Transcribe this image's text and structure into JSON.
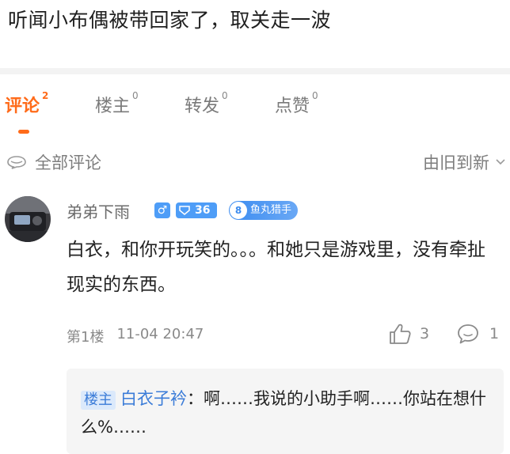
{
  "post": {
    "title": "听闻小布偶被带回家了，取关走一波"
  },
  "tabs": [
    {
      "label": "评论",
      "count": "2",
      "active": true
    },
    {
      "label": "楼主",
      "count": "0",
      "active": false
    },
    {
      "label": "转发",
      "count": "0",
      "active": false
    },
    {
      "label": "点赞",
      "count": "0",
      "active": false
    }
  ],
  "filter": {
    "all_comments": "全部评论",
    "sort": "由旧到新"
  },
  "comment": {
    "username": "弟弟下雨",
    "gender": "♂",
    "level": "36",
    "fan_level": "8",
    "fan_badge": "鱼丸猎手",
    "text": "白衣，和你开玩笑的。。。和她只是游戏里，没有牵扯现实的东西。",
    "floor": "第1楼",
    "time": "11-04 20:47",
    "likes": "3",
    "replies": "1"
  },
  "reply": {
    "op_tag": "楼主",
    "author": "白衣子衿",
    "text": "啊……我说的小助手啊……你站在想什么%……"
  },
  "colors": {
    "accent": "#ff6b1a",
    "badge_blue": "#4e9df7",
    "link_blue": "#3b7cd8"
  }
}
